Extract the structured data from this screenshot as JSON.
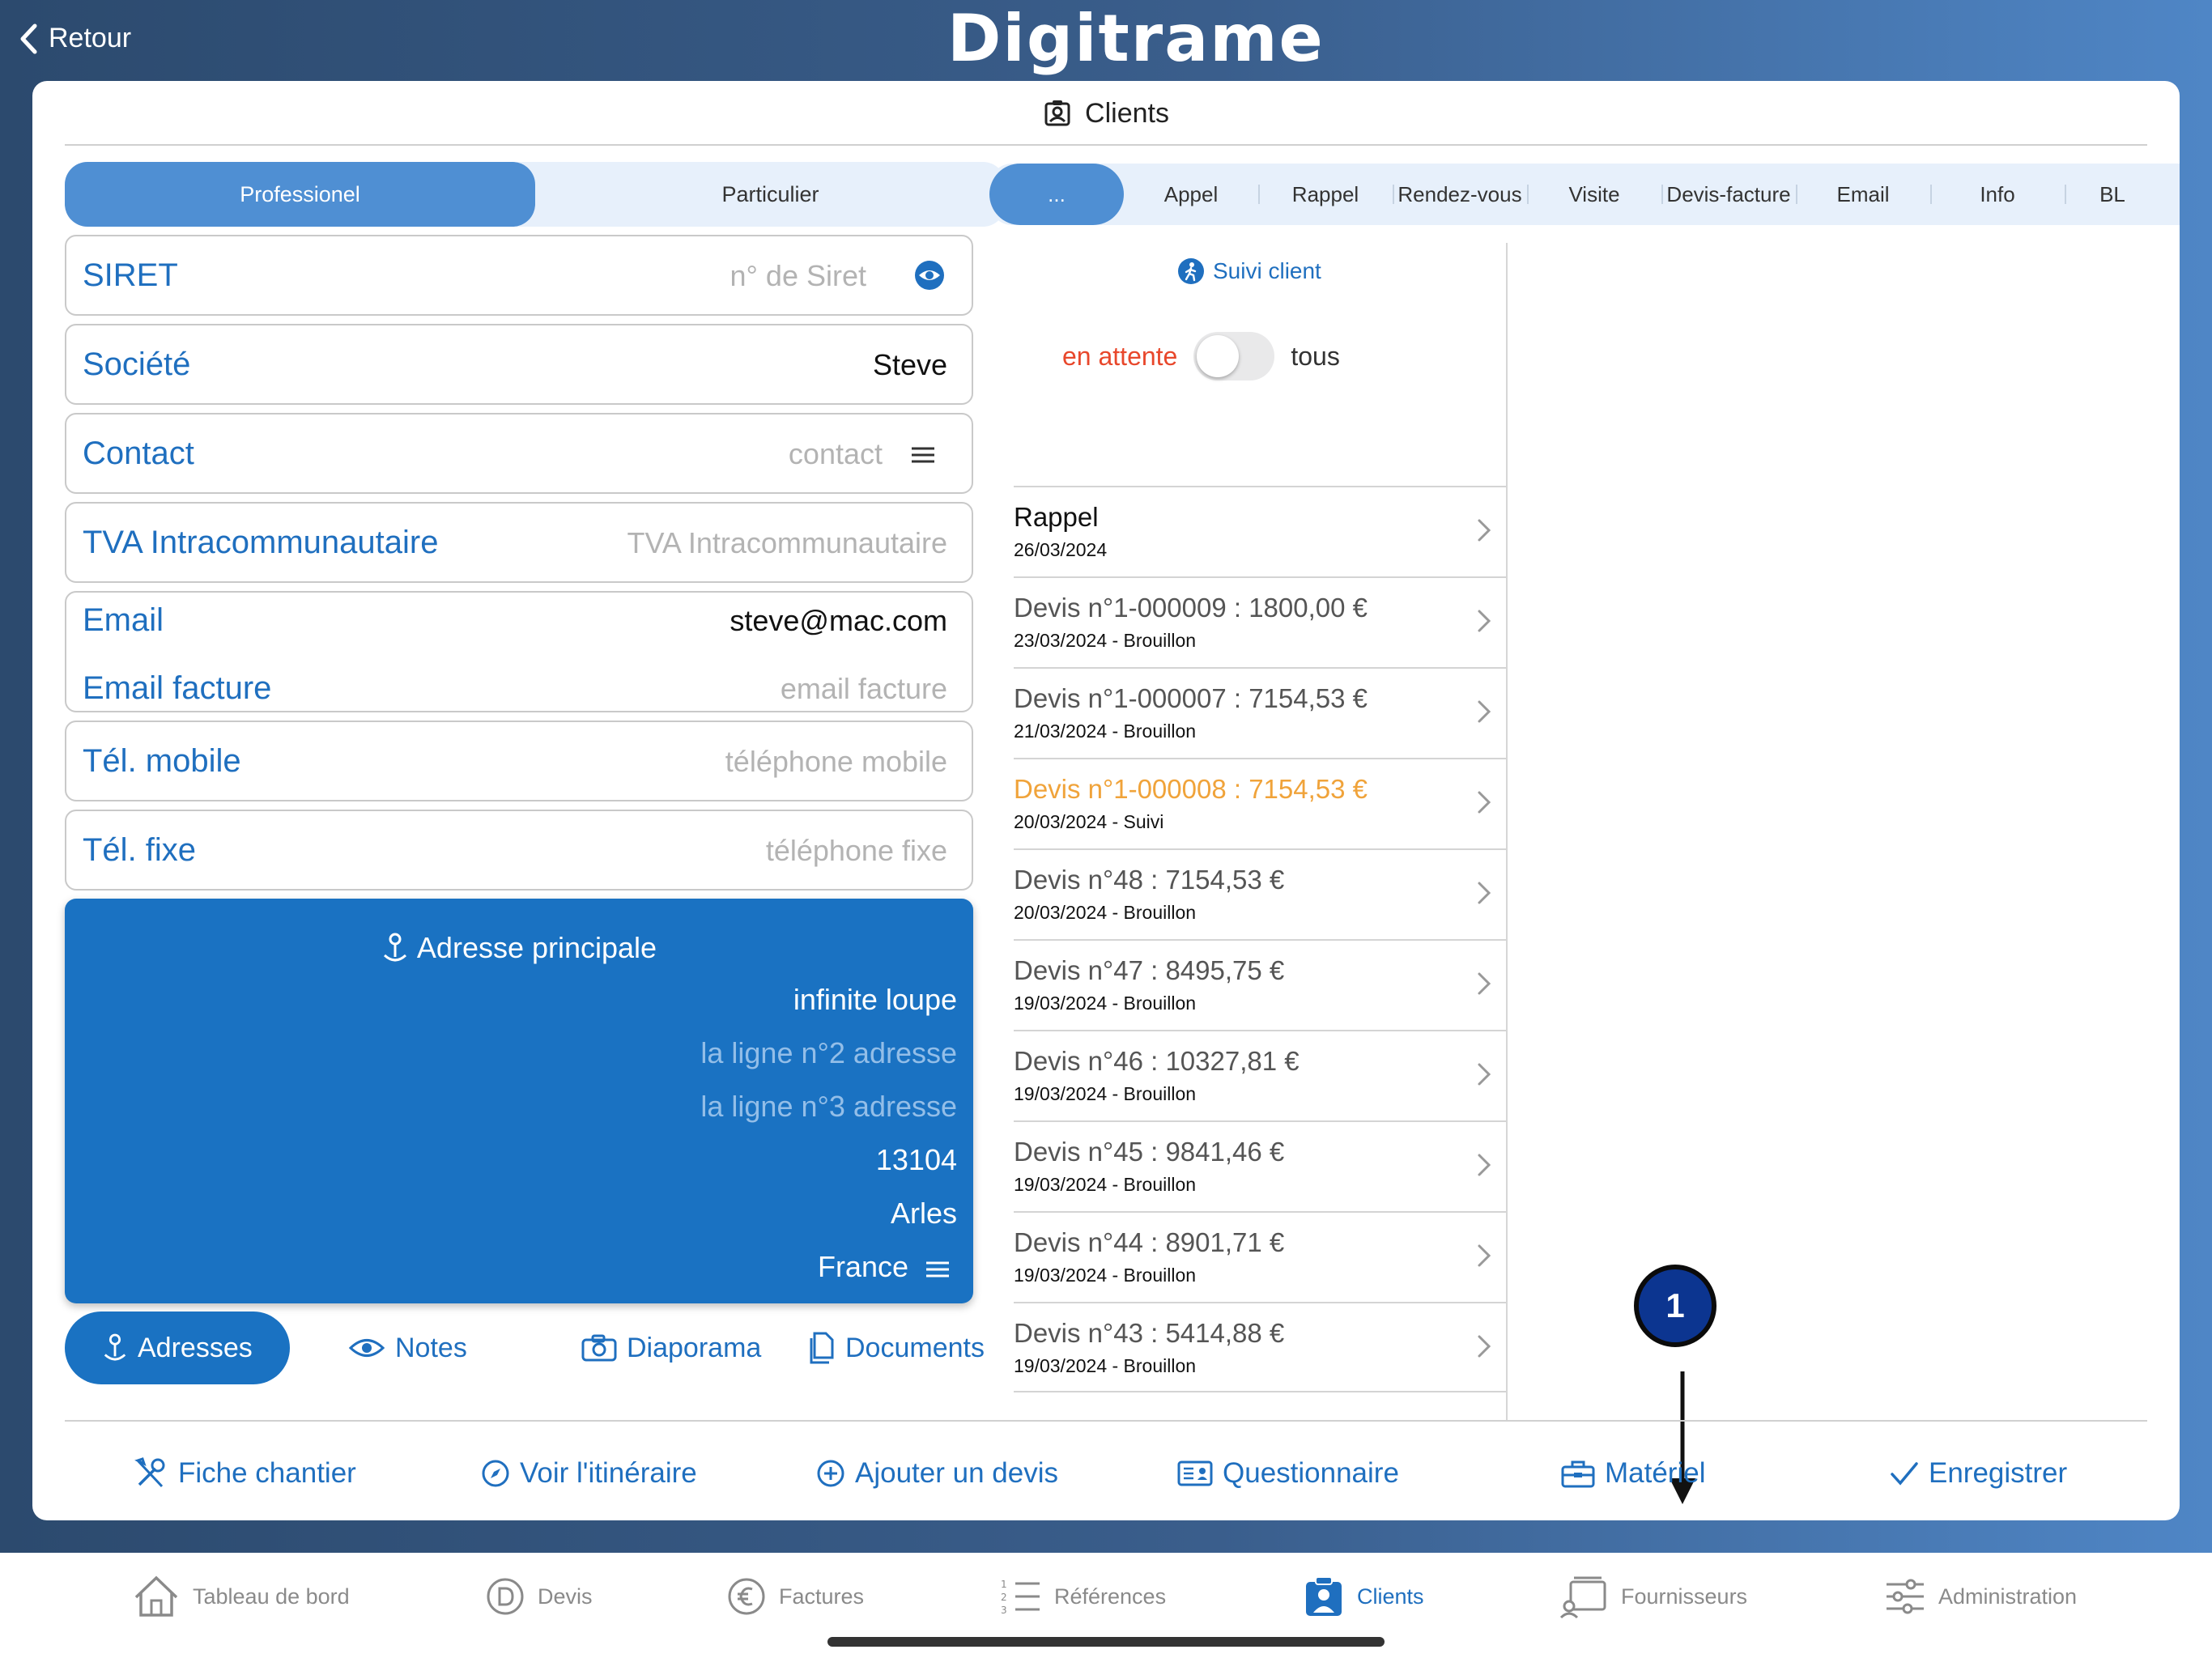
{
  "top": {
    "back_label": "Retour",
    "logo": "Digitrame"
  },
  "card": {
    "title": "Clients"
  },
  "segment": {
    "professional": "Professionel",
    "individual": "Particulier"
  },
  "fields": {
    "siret": {
      "label": "SIRET",
      "placeholder": "n° de Siret"
    },
    "societe": {
      "label": "Société",
      "value": "Steve"
    },
    "contact": {
      "label": "Contact",
      "placeholder": "contact"
    },
    "tva": {
      "label": "TVA Intracommunautaire",
      "placeholder": "TVA Intracommunautaire"
    },
    "email": {
      "label": "Email",
      "value": "steve@mac.com"
    },
    "email_facture": {
      "label": "Email facture",
      "placeholder": "email facture"
    },
    "tel_mobile": {
      "label": "Tél. mobile",
      "placeholder": "téléphone mobile"
    },
    "tel_fixe": {
      "label": "Tél. fixe",
      "placeholder": "téléphone fixe"
    }
  },
  "address": {
    "title": "Adresse principale",
    "line1": "infinite loupe",
    "line2_placeholder": "la ligne n°2 adresse",
    "line3_placeholder": "la ligne n°3 adresse",
    "postal_code": "13104",
    "city": "Arles",
    "country": "France"
  },
  "left_tabs": {
    "adresses": "Adresses",
    "notes": "Notes",
    "diaporama": "Diaporama",
    "documents": "Documents"
  },
  "activity_tabs": [
    "...",
    "Appel",
    "Rappel",
    "Rendez-vous",
    "Visite",
    "Devis-facture",
    "Email",
    "Info",
    "BL"
  ],
  "suivi": {
    "label": "Suivi client"
  },
  "filter": {
    "left": "en attente",
    "right": "tous",
    "toggle_on": false
  },
  "list": [
    {
      "title": "Rappel",
      "subtitle": "26/03/2024"
    },
    {
      "title": "Devis n°1-000009 : 1800,00 €",
      "subtitle": "23/03/2024 - Brouillon"
    },
    {
      "title": "Devis n°1-000007 : 7154,53 €",
      "subtitle": "21/03/2024 - Brouillon"
    },
    {
      "title": "Devis n°1-000008 : 7154,53 €",
      "subtitle": "20/03/2024 - Suivi"
    },
    {
      "title": "Devis n°48 : 7154,53 €",
      "subtitle": "20/03/2024 - Brouillon"
    },
    {
      "title": "Devis n°47 : 8495,75 €",
      "subtitle": "19/03/2024 - Brouillon"
    },
    {
      "title": "Devis n°46 : 10327,81 €",
      "subtitle": "19/03/2024 - Brouillon"
    },
    {
      "title": "Devis n°45 : 9841,46 €",
      "subtitle": "19/03/2024 - Brouillon"
    },
    {
      "title": "Devis n°44 : 8901,71 €",
      "subtitle": "19/03/2024 - Brouillon"
    },
    {
      "title": "Devis n°43 : 5414,88 €",
      "subtitle": "19/03/2024 - Brouillon"
    }
  ],
  "badge": {
    "number": "1"
  },
  "actions": {
    "fiche": "Fiche chantier",
    "itineraire": "Voir l'itinéraire",
    "devis": "Ajouter un devis",
    "questionnaire": "Questionnaire",
    "materiel": "Matériel",
    "enregistrer": "Enregistrer"
  },
  "tabbar": {
    "dashboard": "Tableau de bord",
    "devis": "Devis",
    "factures": "Factures",
    "references": "Références",
    "clients": "Clients",
    "fournisseurs": "Fournisseurs",
    "administration": "Administration"
  },
  "colors": {
    "accent": "#1f6fbf",
    "address_panel": "#1a72c2",
    "warning": "#e8472b",
    "highlight_row": "#f0a33a"
  }
}
